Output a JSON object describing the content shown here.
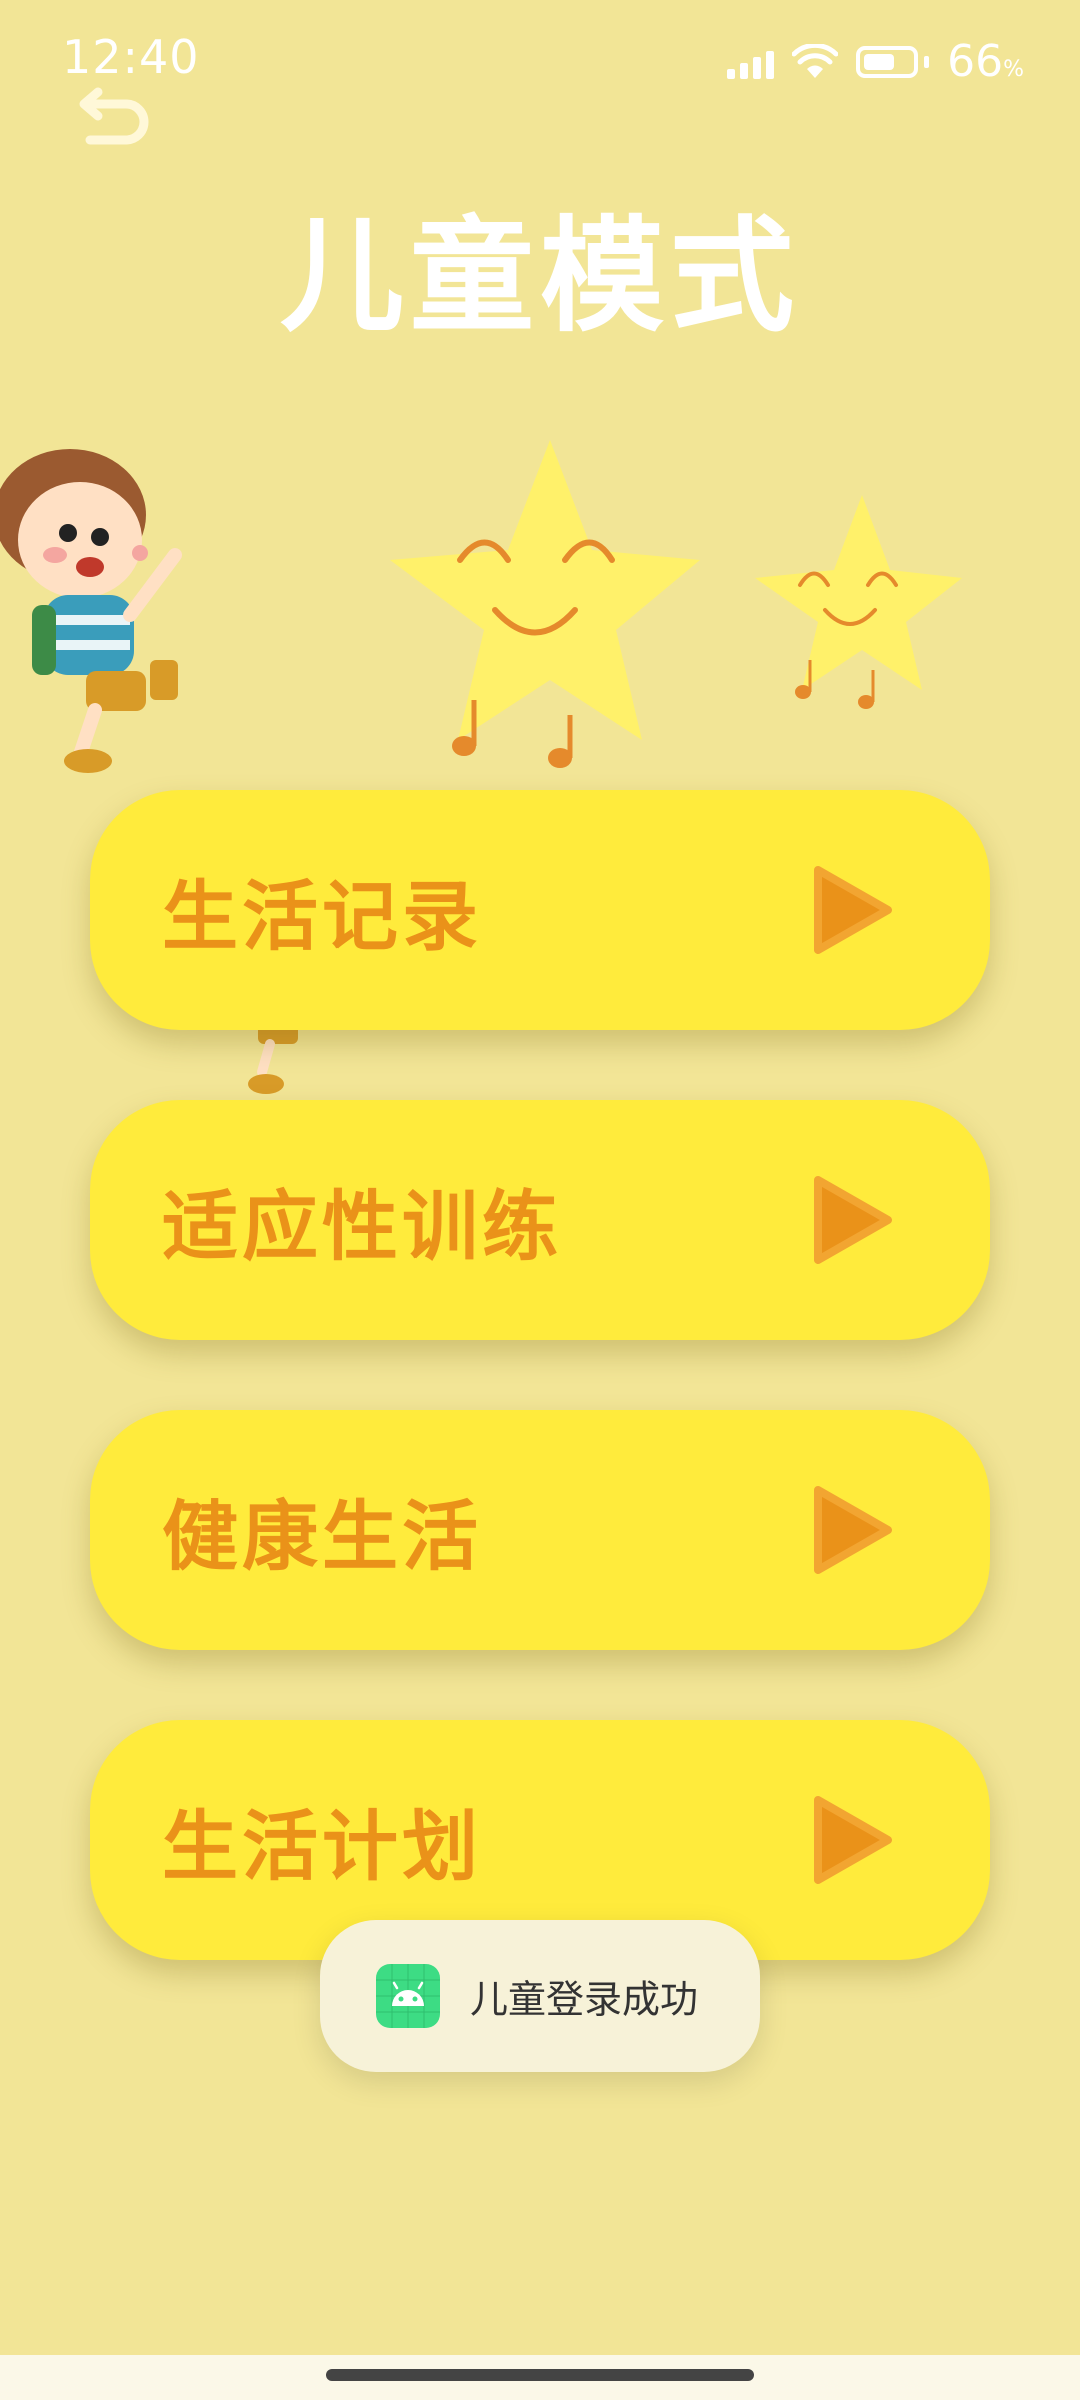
{
  "status_bar": {
    "time": "12:40",
    "battery_percent": "66",
    "battery_unit": "%",
    "battery_level": 0.66,
    "icons": [
      "signal-icon",
      "wifi-icon",
      "battery-icon"
    ]
  },
  "header": {
    "back_icon": "back-arrow-icon",
    "title": "儿童模式"
  },
  "menu": {
    "items": [
      {
        "label": "生活记录",
        "icon": "play-arrow-icon"
      },
      {
        "label": "适应性训练",
        "icon": "play-arrow-icon"
      },
      {
        "label": "健康生活",
        "icon": "play-arrow-icon"
      },
      {
        "label": "生活计划",
        "icon": "play-arrow-icon"
      }
    ]
  },
  "toast": {
    "icon": "android-app-icon",
    "text": "儿童登录成功"
  },
  "colors": {
    "background": "#f2e596",
    "button": "#ffeb3c",
    "button_text": "#ea9219",
    "title": "#ffffff"
  }
}
